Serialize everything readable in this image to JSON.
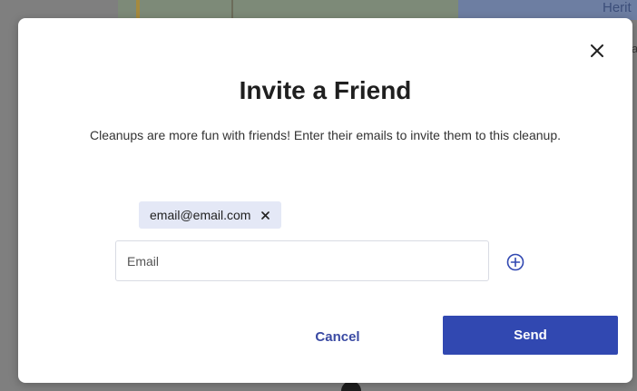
{
  "background": {
    "map_label": "Herit",
    "map_label_small": "a"
  },
  "dialog": {
    "title": "Invite a Friend",
    "description": "Cleanups are more fun with friends! Enter their emails to invite them to this cleanup.",
    "chips": [
      {
        "label": "email@email.com"
      }
    ],
    "email_input": {
      "value": "",
      "placeholder": "Email"
    },
    "cancel_label": "Cancel",
    "send_label": "Send"
  },
  "icons": {
    "close": "close-icon",
    "chip_remove": "close-icon",
    "add": "plus-circle-icon"
  },
  "colors": {
    "primary": "#3148b1",
    "link": "#3a4aa3",
    "chip_bg": "#e4e8f6",
    "overlay": "#7f7f7f"
  }
}
